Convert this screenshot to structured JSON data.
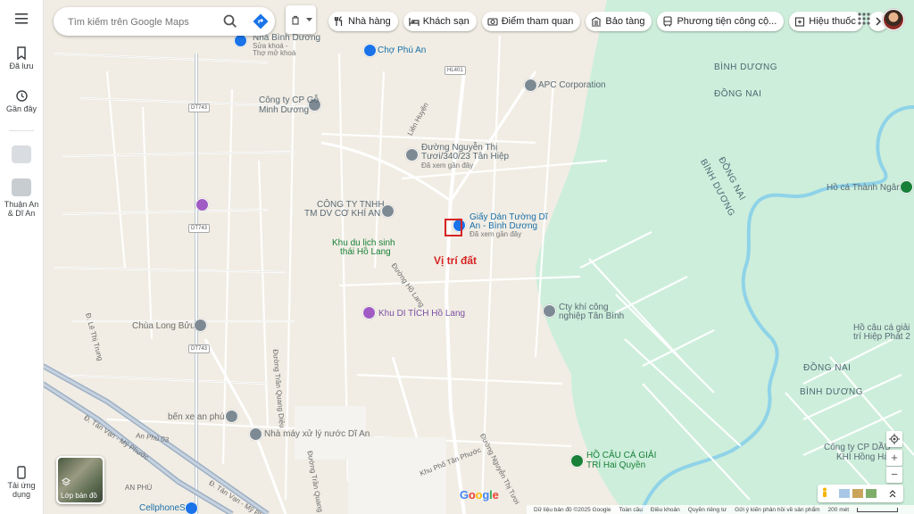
{
  "rail": {
    "menu_label": "",
    "saved_label": "Đã lưu",
    "recent_label": "Gần đây",
    "place_label": "Thuận An & Dĩ An",
    "download_label": "Tải ứng dụng"
  },
  "search": {
    "placeholder": "Tìm kiếm trên Google Maps"
  },
  "chips": [
    {
      "label": "Nhà hàng",
      "icon": "restaurant-icon"
    },
    {
      "label": "Khách sạn",
      "icon": "hotel-icon"
    },
    {
      "label": "Điểm tham quan",
      "icon": "camera-icon"
    },
    {
      "label": "Bảo tàng",
      "icon": "museum-icon"
    },
    {
      "label": "Phương tiện công cộ...",
      "icon": "transit-icon"
    },
    {
      "label": "Hiệu thuốc",
      "icon": "pharmacy-icon"
    }
  ],
  "map": {
    "labels": {
      "nha_binh_duong": "Nhà Bình Dương",
      "sua_khoa": "Sửa khoá -",
      "tho_mo_khoa": "Thợ mở khoá",
      "cho_phu_an": "Chợ Phú An",
      "apc": "APC Corporation",
      "binh_duong_1": "BÌNH DƯƠNG",
      "dong_nai_1": "ĐỒNG NAI",
      "dong_nai_2": "ĐỒNG NAI",
      "binh_duong_2": "BÌNH DƯƠNG",
      "cty_go_1": "Công ty CP Gỗ",
      "cty_go_2": "Minh Dương",
      "lien_huyen": "Liên Huyện",
      "nguyen_thi_tuoi_1": "Đường Nguyễn Thị",
      "nguyen_thi_tuoi_2": "Tươi/340/23 Tân Hiệp",
      "da_xem_1": "Đã xem gần đây",
      "ho_thanh_ngan": "Hồ cá Thành Ngân",
      "cong_ty_1": "CÔNG TY TNHH",
      "cong_ty_2": "TM DV CƠ KHÍ AN",
      "giay_dan_1": "Giấy Dán Tường Dĩ",
      "giay_dan_2": "An - Bình Dương",
      "da_xem_2": "Đã xem gần đây",
      "khu_du_lich_1": "Khu du lịch sinh",
      "khu_du_lich_2": "thái Hồ Lang",
      "duong_ho_lang": "Đường Hồ Lang",
      "cty_khi_1": "Cty khí công",
      "cty_khi_2": "nghiệp Tân Bình",
      "khu_di_tich": "Khu DI TÍCH Hồ Lang",
      "chua_long_buu": "Chùa Long Bửu",
      "ho_cau_1": "Hồ câu cá giải",
      "ho_cau_2": "trí Hiệp Phát 2",
      "dong_nai_3": "ĐỒNG NAI",
      "binh_duong_3": "BÌNH DƯƠNG",
      "le_thi_trung": "Đ. Lê Thị Trung",
      "tran_quang_dieu": "Đường Trần Quang Diệu",
      "ben_xe": "bến xe an phú",
      "nha_may_1": "Nhà máy xử lý nước Dĩ An",
      "an_phu_03": "An Phú 03",
      "tan_van_1": "Đ. Tân Vạn - Mỹ Phước",
      "tan_van_2": "Đ. Tân Vạn - Mỹ Phước",
      "nguyen_thi_tuoi_road": "Đường Nguyễn Thị Tươi",
      "khu_pho_tan_phuoc": "Khu Phố Tân Phước",
      "tran_quang_2": "Đường Trần Quang",
      "ho_cau_ca_1": "HỒ CÂU CÁ GIẢI",
      "ho_cau_ca_2": "TRÍ Hai Quyền",
      "cty_dau_1": "Công ty CP DẦU",
      "cty_dau_2": "KHÍ Hồng Hà",
      "an_phu": "AN PHÚ",
      "cellphones": "CellphoneS",
      "annotation": "Vị trí đất",
      "dt743": "DT743",
      "hl401": "HL401"
    }
  },
  "layer_label": "Lớp bản đồ",
  "google_logo": "Google",
  "footer": {
    "data": "Dữ liệu bản đồ ©2025 Google",
    "global": "Toàn cầu",
    "terms": "Điều khoản",
    "privacy": "Quyền riêng tư",
    "feedback": "Gửi ý kiến phản hồi về sản phẩm",
    "scale": "200 mét"
  },
  "colors": {
    "land": "#f1ede4",
    "forest": "#cdeedb",
    "river": "#8fd3e8",
    "road": "#ffffff",
    "road_outline": "#d5d5d5",
    "highway": "#9db0c6",
    "marker": "#d62424"
  }
}
